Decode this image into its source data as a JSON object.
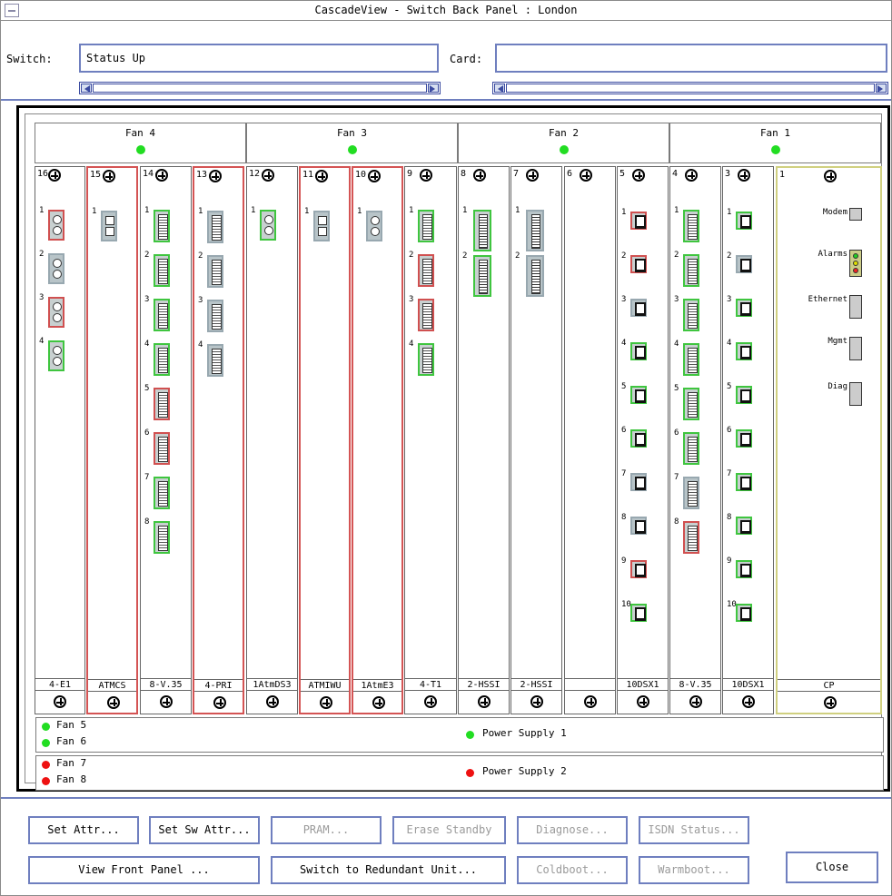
{
  "window": {
    "title": "CascadeView - Switch Back Panel : London"
  },
  "header": {
    "switch_label": "Switch:",
    "switch_value": "Status Up",
    "card_label": "Card:",
    "card_value": ""
  },
  "fans_top": [
    {
      "label": "Fan 4",
      "status": "green"
    },
    {
      "label": "Fan 3",
      "status": "green"
    },
    {
      "label": "Fan 2",
      "status": "green"
    },
    {
      "label": "Fan 1",
      "status": "green"
    }
  ],
  "slots": [
    {
      "num": "16",
      "label": "4-E1",
      "frame": "normal"
    },
    {
      "num": "15",
      "label": "ATMCS",
      "frame": "red"
    },
    {
      "num": "14",
      "label": "8-V.35",
      "frame": "normal"
    },
    {
      "num": "13",
      "label": "4-PRI",
      "frame": "red"
    },
    {
      "num": "12",
      "label": "1AtmDS3",
      "frame": "normal"
    },
    {
      "num": "11",
      "label": "ATMIWU",
      "frame": "red"
    },
    {
      "num": "10",
      "label": "1AtmE3",
      "frame": "red"
    },
    {
      "num": "9",
      "label": "4-T1",
      "frame": "normal"
    },
    {
      "num": "8",
      "label": "2-HSSI",
      "frame": "normal"
    },
    {
      "num": "7",
      "label": "2-HSSI",
      "frame": "normal"
    },
    {
      "num": "6",
      "label": "",
      "frame": "normal"
    },
    {
      "num": "5",
      "label": "10DSX1",
      "frame": "normal"
    },
    {
      "num": "4",
      "label": "8-V.35",
      "frame": "normal"
    },
    {
      "num": "3",
      "label": "10DSX1",
      "frame": "normal"
    },
    {
      "num": "1",
      "label": "CP",
      "frame": "yellow"
    }
  ],
  "cp_ports": [
    "Modem",
    "Alarms",
    "Ethernet",
    "Mgmt",
    "Diag"
  ],
  "status_rows": [
    {
      "fans": [
        {
          "label": "Fan 5",
          "status": "green"
        },
        {
          "label": "Fan 6",
          "status": "green"
        }
      ],
      "supply": {
        "label": "Power Supply 1",
        "status": "green"
      }
    },
    {
      "fans": [
        {
          "label": "Fan 7",
          "status": "red"
        },
        {
          "label": "Fan 8",
          "status": "red"
        }
      ],
      "supply": {
        "label": "Power Supply 2",
        "status": "red"
      }
    }
  ],
  "buttons": {
    "set_attr": "Set Attr...",
    "set_sw_attr": "Set Sw Attr...",
    "pram": "PRAM...",
    "erase_standby": "Erase Standby",
    "diagnose": "Diagnose...",
    "isdn_status": "ISDN Status...",
    "view_front_panel": "View Front Panel ...",
    "switch_redundant": "Switch to Redundant Unit...",
    "coldboot": "Coldboot...",
    "warmboot": "Warmboot...",
    "close": "Close"
  },
  "colors": {
    "green": "#22dd22",
    "red": "#ee1111",
    "accent": "#6f7fbf"
  }
}
